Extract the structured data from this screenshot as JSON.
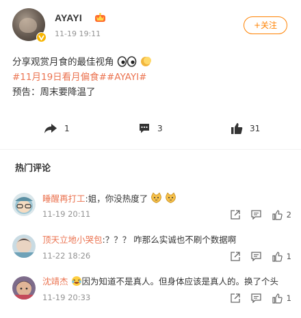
{
  "post": {
    "username": "AYAYI",
    "time": "11-19 19:11",
    "follow_label": "+关注",
    "text_line1": "分享观赏月食的最佳视角",
    "topics": "#11月19日看月偏食##AYAYI#",
    "text_line3": "预告：周末要降温了"
  },
  "actions": {
    "repost_count": "1",
    "comment_count": "3",
    "like_count": "31"
  },
  "comments_section": {
    "title": "热门评论"
  },
  "comments": [
    {
      "name": "睡醒再打工",
      "text": ":姐，你没热度了",
      "time": "11-19 20:11",
      "likes": "2"
    },
    {
      "name": "顶天立地小哭包",
      "text": ":？？？ 咋那么实诚也不刷个数据啊",
      "time": "11-22 18:26",
      "likes": "1"
    },
    {
      "name": "沈靖杰",
      "text": "因为知道不是真人。但身体应该是真人的。换了个头",
      "time": "11-19 20:33",
      "likes": "1"
    }
  ],
  "colors": {
    "accent_orange": "#ff8200",
    "topic_link": "#eb7350",
    "secondary_text": "#939393"
  },
  "icons": [
    "vip-badge-icon",
    "level-crown-icon",
    "eyes-emoji-icon",
    "moon-emoji-icon",
    "repost-icon",
    "comment-icon",
    "like-icon",
    "cat-emoji-icon",
    "share-icon"
  ]
}
